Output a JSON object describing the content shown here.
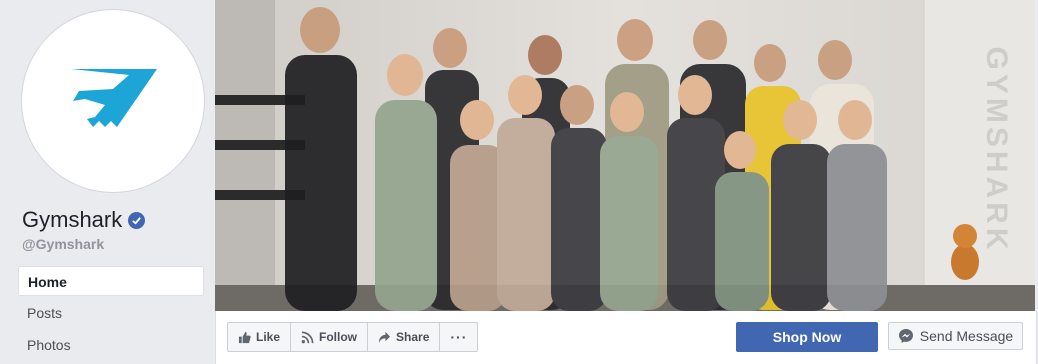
{
  "page": {
    "name": "Gymshark",
    "handle": "@Gymshark",
    "cover_watermark": "GYMSHARK"
  },
  "nav": {
    "items": [
      {
        "label": "Home",
        "active": true
      },
      {
        "label": "Posts",
        "active": false
      },
      {
        "label": "Photos",
        "active": false
      }
    ]
  },
  "actions": {
    "like_label": "Like",
    "follow_label": "Follow",
    "share_label": "Share",
    "more_label": "···",
    "shop_label": "Shop Now",
    "message_label": "Send Message"
  },
  "colors": {
    "brand_blue": "#4267b2",
    "logo_blue": "#1ea5d8",
    "background": "#e9ebee"
  },
  "icons": {
    "logo": "gymshark-shark-logo",
    "verified": "verified-check-icon",
    "like": "thumbs-up-icon",
    "follow": "rss-icon",
    "share": "share-arrow-icon",
    "message": "messenger-icon"
  }
}
